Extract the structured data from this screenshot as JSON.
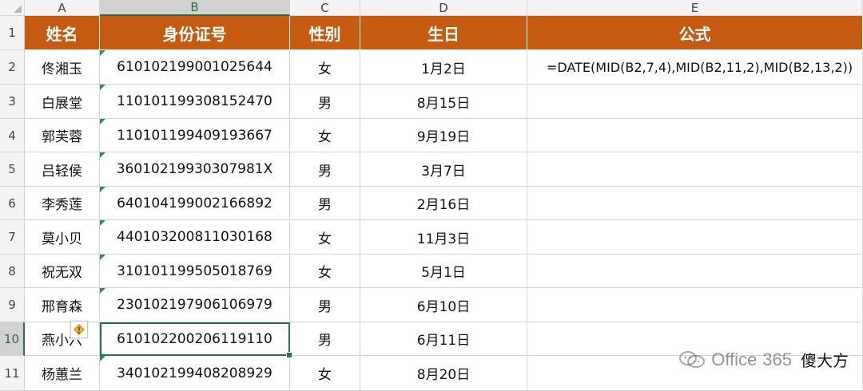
{
  "spreadsheet": {
    "columns": [
      "A",
      "B",
      "C",
      "D",
      "E"
    ],
    "rows": [
      "1",
      "2",
      "3",
      "4",
      "5",
      "6",
      "7",
      "8",
      "9",
      "10",
      "11"
    ],
    "selected_column": "B",
    "selected_row": "10",
    "headers": {
      "name": "姓名",
      "id": "身份证号",
      "gender": "性别",
      "birthday": "生日",
      "formula": "公式"
    },
    "data": [
      {
        "name": "佟湘玉",
        "id": "610102199001025644",
        "gender": "女",
        "birthday": "1月2日",
        "formula": "=DATE(MID(B2,7,4),MID(B2,11,2),MID(B2,13,2))"
      },
      {
        "name": "白展堂",
        "id": "110101199308152470",
        "gender": "男",
        "birthday": "8月15日",
        "formula": ""
      },
      {
        "name": "郭芙蓉",
        "id": "110101199409193667",
        "gender": "女",
        "birthday": "9月19日",
        "formula": ""
      },
      {
        "name": "吕轻侯",
        "id": "36010219930307981X",
        "gender": "男",
        "birthday": "3月7日",
        "formula": ""
      },
      {
        "name": "李秀莲",
        "id": "640104199002166892",
        "gender": "男",
        "birthday": "2月16日",
        "formula": ""
      },
      {
        "name": "莫小贝",
        "id": "440103200811030168",
        "gender": "女",
        "birthday": "11月3日",
        "formula": ""
      },
      {
        "name": "祝无双",
        "id": "310101199505018769",
        "gender": "女",
        "birthday": "5月1日",
        "formula": ""
      },
      {
        "name": "邢育森",
        "id": "230102197906106979",
        "gender": "男",
        "birthday": "6月10日",
        "formula": ""
      },
      {
        "name": "燕小六",
        "id": "610102200206119110",
        "gender": "男",
        "birthday": "6月11日",
        "formula": ""
      },
      {
        "name": "杨蕙兰",
        "id": "340102199408208929",
        "gender": "女",
        "birthday": "8月20日",
        "formula": ""
      }
    ]
  },
  "watermark": {
    "brand": "Office",
    "suffix": "365",
    "chinese": "傻大方"
  },
  "colors": {
    "header_fill": "#c55a11",
    "selection": "#217346",
    "indicator": "#2f8f4a"
  },
  "icons": {
    "sheet_corner": "select-all-triangle-icon",
    "error_indicator": "green-triangle-icon",
    "smart_tag": "warning-diamond-icon",
    "watermark": "wechat-bubble-icon"
  }
}
